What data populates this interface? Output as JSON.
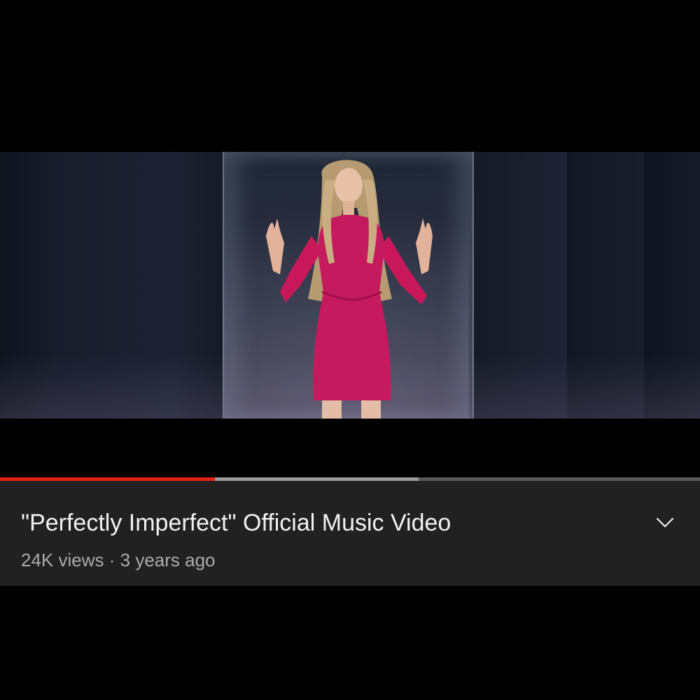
{
  "player": {
    "progress": {
      "played_fraction": 0.307,
      "buffered_fraction": 0.598
    },
    "colors": {
      "played": "#e62117",
      "buffered": "#9a9a9a",
      "track": "#5a5a5a"
    }
  },
  "video": {
    "title": "\"Perfectly Imperfect\" Official Music Video",
    "views": "24K views",
    "separator": "·",
    "age": "3 years ago"
  },
  "icons": {
    "expand": "chevron-down-icon"
  },
  "colors": {
    "panel_bg": "#212121",
    "title": "#f1f1f1",
    "meta": "#aaaaaa"
  }
}
